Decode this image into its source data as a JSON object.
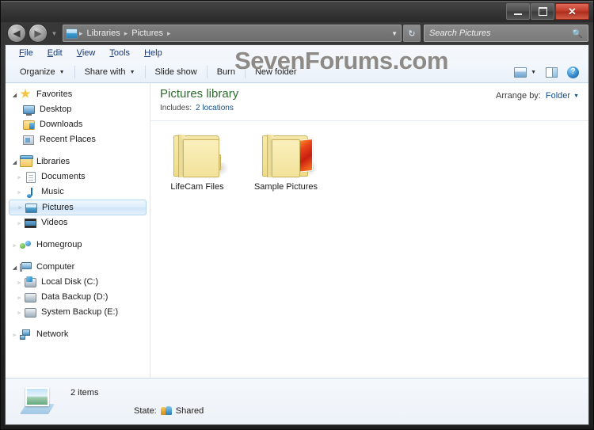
{
  "window": {
    "titlebar_buttons": [
      {
        "name": "minimize",
        "label": "–"
      },
      {
        "name": "maximize",
        "label": "❐"
      },
      {
        "name": "close",
        "label": "✕"
      }
    ]
  },
  "addressbar": {
    "back_glyph": "◀",
    "forward_glyph": "▶",
    "history_glyph": "▼",
    "folder_icon": "pictures-library-icon",
    "breadcrumbs": [
      "Libraries",
      "Pictures"
    ],
    "separator": "▸",
    "dropdown_glyph": "▼",
    "refresh_glyph": "↻"
  },
  "search": {
    "placeholder": "Search Pictures",
    "value": "",
    "icon": "search-icon"
  },
  "menubar": {
    "items": [
      {
        "accel": "F",
        "rest": "ile"
      },
      {
        "accel": "E",
        "rest": "dit"
      },
      {
        "accel": "V",
        "rest": "iew"
      },
      {
        "accel": "T",
        "rest": "ools"
      },
      {
        "accel": "H",
        "rest": "elp"
      }
    ]
  },
  "toolbar": {
    "organize": "Organize",
    "share_with": "Share with",
    "slide_show": "Slide show",
    "burn": "Burn",
    "new_folder": "New folder",
    "caret": "▼",
    "views_icon": "change-view-icon",
    "views_caret": "▼",
    "preview_pane_icon": "preview-pane-icon",
    "help_icon": "help-icon",
    "help_glyph": "?"
  },
  "watermark": {
    "text": "SevenForums.com"
  },
  "navpane": {
    "groups": [
      {
        "name": "favorites",
        "root": {
          "label": "Favorites",
          "icon": "star-icon",
          "twisty": "◢"
        },
        "children": [
          {
            "label": "Desktop",
            "icon": "desktop-icon"
          },
          {
            "label": "Downloads",
            "icon": "downloads-folder-icon"
          },
          {
            "label": "Recent Places",
            "icon": "recent-places-icon"
          }
        ]
      },
      {
        "name": "libraries",
        "root": {
          "label": "Libraries",
          "icon": "libraries-icon",
          "twisty": "◢"
        },
        "children": [
          {
            "label": "Documents",
            "icon": "documents-library-icon",
            "twisty": "▹"
          },
          {
            "label": "Music",
            "icon": "music-library-icon",
            "twisty": "▹"
          },
          {
            "label": "Pictures",
            "icon": "pictures-library-icon",
            "twisty": "▹",
            "selected": true
          },
          {
            "label": "Videos",
            "icon": "videos-library-icon",
            "twisty": "▹"
          }
        ]
      },
      {
        "name": "homegroup",
        "root": {
          "label": "Homegroup",
          "icon": "homegroup-icon",
          "twisty": "▹"
        },
        "children": []
      },
      {
        "name": "computer",
        "root": {
          "label": "Computer",
          "icon": "computer-icon",
          "twisty": "◢"
        },
        "children": [
          {
            "label": "Local Disk (C:)",
            "icon": "system-drive-icon",
            "twisty": "▹"
          },
          {
            "label": "Data Backup (D:)",
            "icon": "drive-icon",
            "twisty": "▹"
          },
          {
            "label": "System Backup (E:)",
            "icon": "drive-icon",
            "twisty": "▹"
          }
        ]
      },
      {
        "name": "network",
        "root": {
          "label": "Network",
          "icon": "network-icon",
          "twisty": "▹"
        },
        "children": []
      }
    ]
  },
  "library_header": {
    "title": "Pictures library",
    "includes_label": "Includes:",
    "includes_link": "2 locations",
    "arrange_label": "Arrange by:",
    "arrange_value": "Folder",
    "arrange_caret": "▼"
  },
  "items": [
    {
      "label": "LifeCam Files",
      "icon": "folder-icon",
      "has_thumbnails": false
    },
    {
      "label": "Sample Pictures",
      "icon": "folder-with-pictures-icon",
      "has_thumbnails": true
    }
  ],
  "statusbar": {
    "icon": "pictures-library-icon",
    "item_count": "2 items",
    "state_label": "State:",
    "state_icon": "shared-icon",
    "state_value": "Shared"
  },
  "colors": {
    "library_title": "#2e6b2e",
    "link": "#15508e",
    "menu_text": "#15387a",
    "watermark": "#8e8a86",
    "close_button": "#c03a28",
    "selection": "#cfe4f8"
  }
}
